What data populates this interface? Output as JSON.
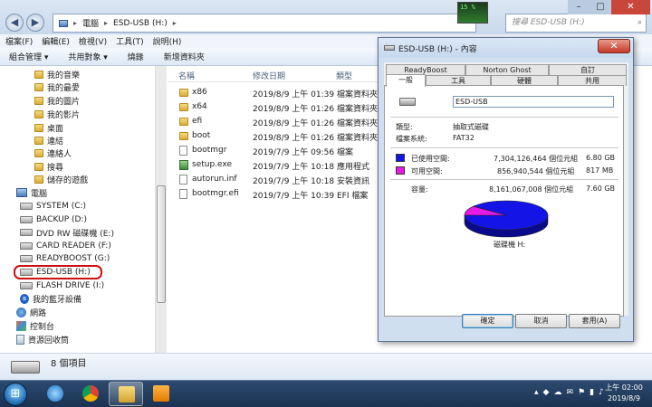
{
  "explorer": {
    "breadcrumb": [
      "電腦",
      "ESD-USB (H:)"
    ],
    "search_placeholder": "搜尋 ESD-USB (H:)",
    "perf_widget": "15 %",
    "menu": [
      "檔案(F)",
      "編輯(E)",
      "檢視(V)",
      "工具(T)",
      "說明(H)"
    ],
    "toolbar": [
      "組合管理 ▾",
      "共用對象 ▾",
      "燒錄",
      "新增資料夾"
    ],
    "nav": {
      "libraries": [
        "我的音樂",
        "我的最愛",
        "我的圖片",
        "我的影片",
        "桌面",
        "連結",
        "連絡人",
        "搜尋",
        "儲存的遊戲"
      ],
      "computer": "電腦",
      "drives": [
        "SYSTEM (C:)",
        "BACKUP (D:)",
        "DVD RW 磁碟機 (E:)",
        "CARD READER (F:)",
        "READYBOOST (G:)",
        "ESD-USB (H:)",
        "FLASH DRIVE (I:)"
      ],
      "bluetooth": "我的藍牙設備",
      "network": "網路",
      "control_panel": "控制台",
      "recycle_bin": "資源回收筒"
    },
    "columns": {
      "name": "名稱",
      "date": "修改日期",
      "type": "類型"
    },
    "files": [
      {
        "name": "x86",
        "date": "2019/8/9 上午 01:39",
        "type": "檔案資料夾",
        "kind": "folder"
      },
      {
        "name": "x64",
        "date": "2019/8/9 上午 01:26",
        "type": "檔案資料夾",
        "kind": "folder"
      },
      {
        "name": "efi",
        "date": "2019/8/9 上午 01:26",
        "type": "檔案資料夾",
        "kind": "folder"
      },
      {
        "name": "boot",
        "date": "2019/8/9 上午 01:26",
        "type": "檔案資料夾",
        "kind": "folder"
      },
      {
        "name": "bootmgr",
        "date": "2019/7/9 上午 09:56",
        "type": "檔案",
        "kind": "file"
      },
      {
        "name": "setup.exe",
        "date": "2019/7/9 上午 10:18",
        "type": "應用程式",
        "kind": "exe"
      },
      {
        "name": "autorun.inf",
        "date": "2019/7/9 上午 10:18",
        "type": "安裝資訊",
        "kind": "file"
      },
      {
        "name": "bootmgr.efi",
        "date": "2019/7/9 上午 10:39",
        "type": "EFI 檔案",
        "kind": "file"
      }
    ],
    "status": "8 個項目"
  },
  "dialog": {
    "title": "ESD-USB (H:) - 內容",
    "tabs_back": [
      "ReadyBoost",
      "Norton Ghost",
      "自訂"
    ],
    "tabs_front": [
      "一般",
      "工具",
      "硬體",
      "共用"
    ],
    "volume_label": "ESD-USB",
    "type_label": "類型:",
    "type_value": "抽取式磁碟",
    "fs_label": "檔案系統:",
    "fs_value": "FAT32",
    "used_label": "已使用空間:",
    "used_bytes": "7,304,126,464 個位元組",
    "used_size": "6.80 GB",
    "free_label": "可用空間:",
    "free_bytes": "856,940,544 個位元組",
    "free_size": "817 MB",
    "capacity_label": "容量:",
    "capacity_bytes": "8,161,067,008 個位元組",
    "capacity_size": "7.60 GB",
    "drive_label": "磁碟機 H:",
    "used_fraction": 0.895,
    "buttons": {
      "ok": "確定",
      "cancel": "取消",
      "apply": "套用(A)"
    },
    "colors": {
      "used": "#1414e6",
      "free": "#e619e6"
    }
  },
  "taskbar": {
    "start": "⊞",
    "time": "上午 02:00",
    "date": "2019/8/9"
  }
}
